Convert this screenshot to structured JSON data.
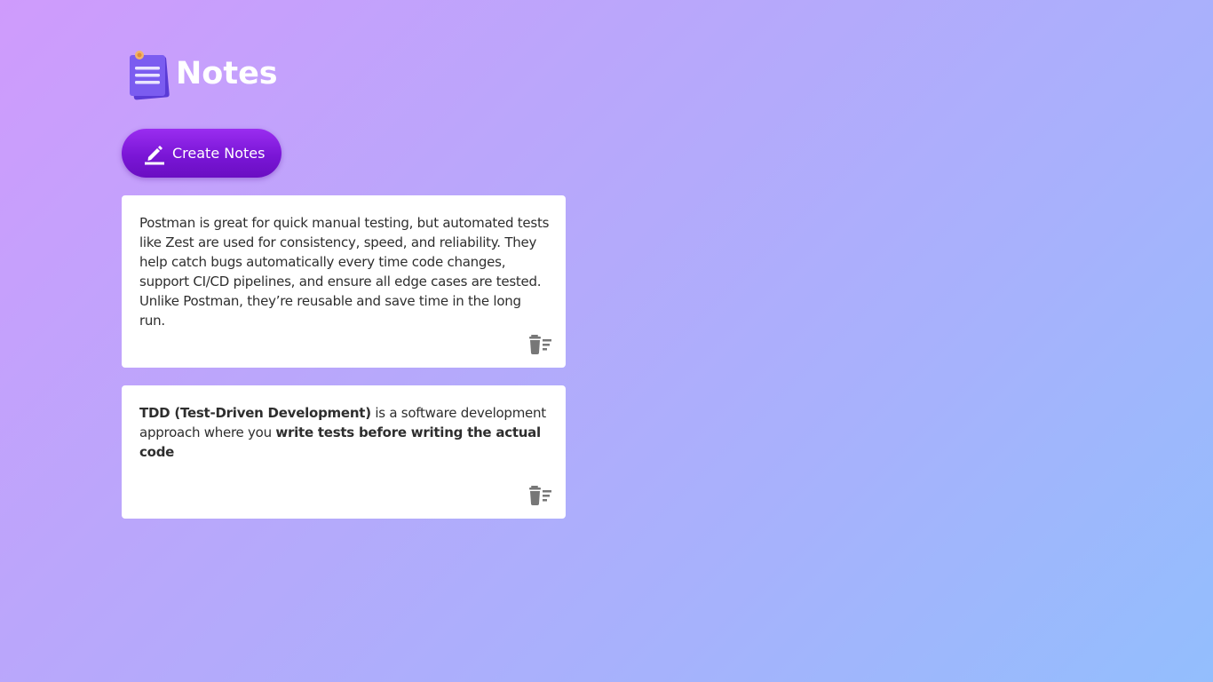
{
  "app": {
    "title": "Notes",
    "logo_icon": "notepad-icon"
  },
  "toolbar": {
    "create_label": "Create Notes",
    "create_icon": "pencil-icon"
  },
  "notes": [
    {
      "segments": [
        {
          "text": "Postman is great for quick manual testing, but automated tests like Zest are used for consistency, speed, and reliability. They help catch bugs automatically every time code changes, support CI/CD pipelines, and ensure all edge cases are tested. Unlike Postman, they’re reusable and save time in the long run.",
          "bold": false
        }
      ],
      "delete_icon": "delete-icon"
    },
    {
      "segments": [
        {
          "text": "TDD (Test-Driven Development)",
          "bold": true
        },
        {
          "text": " is a software development approach where you ",
          "bold": false
        },
        {
          "text": "write tests before writing the actual code",
          "bold": true
        }
      ],
      "delete_icon": "delete-icon"
    }
  ],
  "colors": {
    "button_primary": "#7a16d6",
    "card_background": "#ffffff",
    "icon_gray": "#777777"
  }
}
